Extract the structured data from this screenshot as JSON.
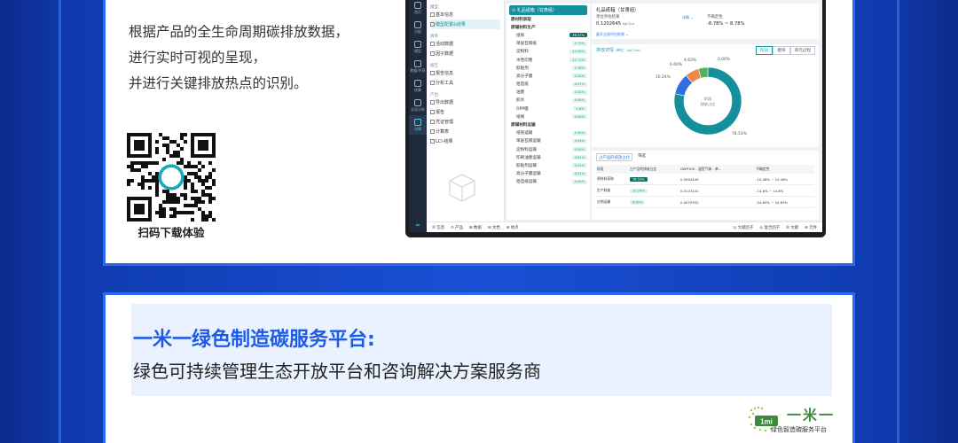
{
  "intro": {
    "lines": [
      "根据产品的全生命周期碳排放数据，",
      "进行实时可视的呈现，",
      "并进行关键排放热点的识别。"
    ],
    "qr_label": "扫码下载体验"
  },
  "app": {
    "rail": [
      {
        "label": "首页"
      },
      {
        "label": "分配"
      },
      {
        "label": "模型"
      },
      {
        "label": "数据/共享"
      },
      {
        "label": "核算"
      },
      {
        "label": "全局分析"
      },
      {
        "label": "详情"
      }
    ],
    "nav": {
      "sections": [
        {
          "title": "模型",
          "items": [
            "基本信息",
            "模型配置&结果"
          ]
        },
        {
          "title": "清单",
          "items": [
            "活动数据",
            "因子数据"
          ]
        },
        {
          "title": "报告",
          "items": [
            "报告信息",
            "分析工具"
          ]
        },
        {
          "title": "产出",
          "items": [
            "导出数据",
            "报告",
            "凭证管理",
            "计算表",
            "LCI-结果"
          ]
        }
      ]
    },
    "tree": {
      "head": "⊙ 礼品纸箱（甘肃组）",
      "rows": [
        {
          "label": "原材料获取",
          "pill": "",
          "level": 1
        },
        {
          "label": "原辅材料生产",
          "pill": "",
          "level": 1
        },
        {
          "label": "纸张",
          "pill": "36.37%",
          "level": 2,
          "dark": true
        },
        {
          "label": "单层瓦楞纸",
          "pill": "0.72%",
          "level": 2
        },
        {
          "label": "淀粉料",
          "pill": "12.96%",
          "level": 2
        },
        {
          "label": "水性印墨",
          "pill": "12.71%",
          "level": 2
        },
        {
          "label": "胶粘剂",
          "pill": "1.76%",
          "level": 2
        },
        {
          "label": "高分子膜",
          "pill": "0.32%",
          "level": 2
        },
        {
          "label": "铝箔纸",
          "pill": "0.07%",
          "level": 2
        },
        {
          "label": "油墨",
          "pill": "0.02%",
          "level": 2
        },
        {
          "label": "胶水",
          "pill": "0.06%",
          "level": 2
        },
        {
          "label": "OPP膜",
          "pill": "1.6%",
          "level": 2
        },
        {
          "label": "纸绳",
          "pill": "0.06%",
          "level": 2
        },
        {
          "label": "原辅材料运输",
          "pill": "",
          "level": 1
        },
        {
          "label": "纸张运输",
          "pill": "1.55%",
          "level": 2
        },
        {
          "label": "单层瓦楞运输",
          "pill": "0.03%",
          "level": 2
        },
        {
          "label": "淀粉料运输",
          "pill": "0.09%",
          "level": 2
        },
        {
          "label": "印刷油墨运输",
          "pill": "0.61%",
          "level": 2
        },
        {
          "label": "胶粘剂运输",
          "pill": "0.01%",
          "level": 2
        },
        {
          "label": "高分子膜运输",
          "pill": "0.01%",
          "level": 2
        },
        {
          "label": "铝箔纸运输",
          "pill": "0.00%",
          "level": 2
        }
      ]
    },
    "summary": {
      "title": "礼品纸箱（甘肃组）",
      "unit_label": "单位评估结果",
      "value": "0.1202645",
      "value_unit": "kgCO₂e",
      "uncert_label": "不确定性",
      "uncert_value": "-8.78% ~ 8.78%",
      "link": "展开全部评估结果 ⌄",
      "dropdown": "详情 ⌄"
    },
    "emission": {
      "title": "排放详情",
      "unit": "(单位：kgCO₂e)",
      "tabs": [
        "阶段",
        "模块",
        "单元过程"
      ],
      "center_line1": "阶段",
      "center_line2": "排放占比"
    },
    "table": {
      "toolbar_main": "占产品的排放占比",
      "toolbar_filter": "筛选",
      "headers": [
        "阶段",
        "占产品的排放占比",
        "GWP100 - 温室气体 - 单...",
        "不确定性"
      ],
      "rows": [
        [
          "原材料获取",
          "78.53%",
          "0.0944449",
          "-10.46% ~ 10.46%"
        ],
        [
          "生产制造",
          "10.24%",
          "0.0123141",
          "-14.8% ~ 14.8%"
        ],
        [
          "分销运输",
          "6.60%",
          "0.0079332",
          "-34.63% ~ 34.63%"
        ]
      ]
    },
    "footer": {
      "left": [
        "☰ 信息",
        "⊙ 产品",
        "⊞ 数据",
        "⊟ 文档",
        "⊕ 地点"
      ],
      "right": [
        "◎ 文献因子",
        "◎ 复合因子",
        "☰ 文献",
        "⊕ 元件"
      ]
    }
  },
  "chart_data": {
    "type": "pie",
    "categories": [
      "原材料获取",
      "生产制造",
      "分销运输",
      "其他",
      "其他2"
    ],
    "values": [
      78.53,
      10.24,
      6.6,
      4.63,
      0.0
    ],
    "labels": [
      "78.53%",
      "10.24%",
      "6.60%",
      "4.63%",
      "0.00%"
    ],
    "colors": [
      "#168f9c",
      "#2f6fe0",
      "#f0874a",
      "#55b35a",
      "#8aa0b8"
    ]
  },
  "slogan": {
    "title": "一米一绿色制造碳服务平台:",
    "subtitle": "绿色可持续管理生态开放平台和咨询解决方案服务商"
  },
  "logo": {
    "mark": "1mi",
    "text": "一米一",
    "sub": "绿色智造碳服务平台"
  },
  "colors": {
    "accent": "#1e5ce8",
    "teal": "#15909c",
    "frame": "#2d6cf0"
  }
}
